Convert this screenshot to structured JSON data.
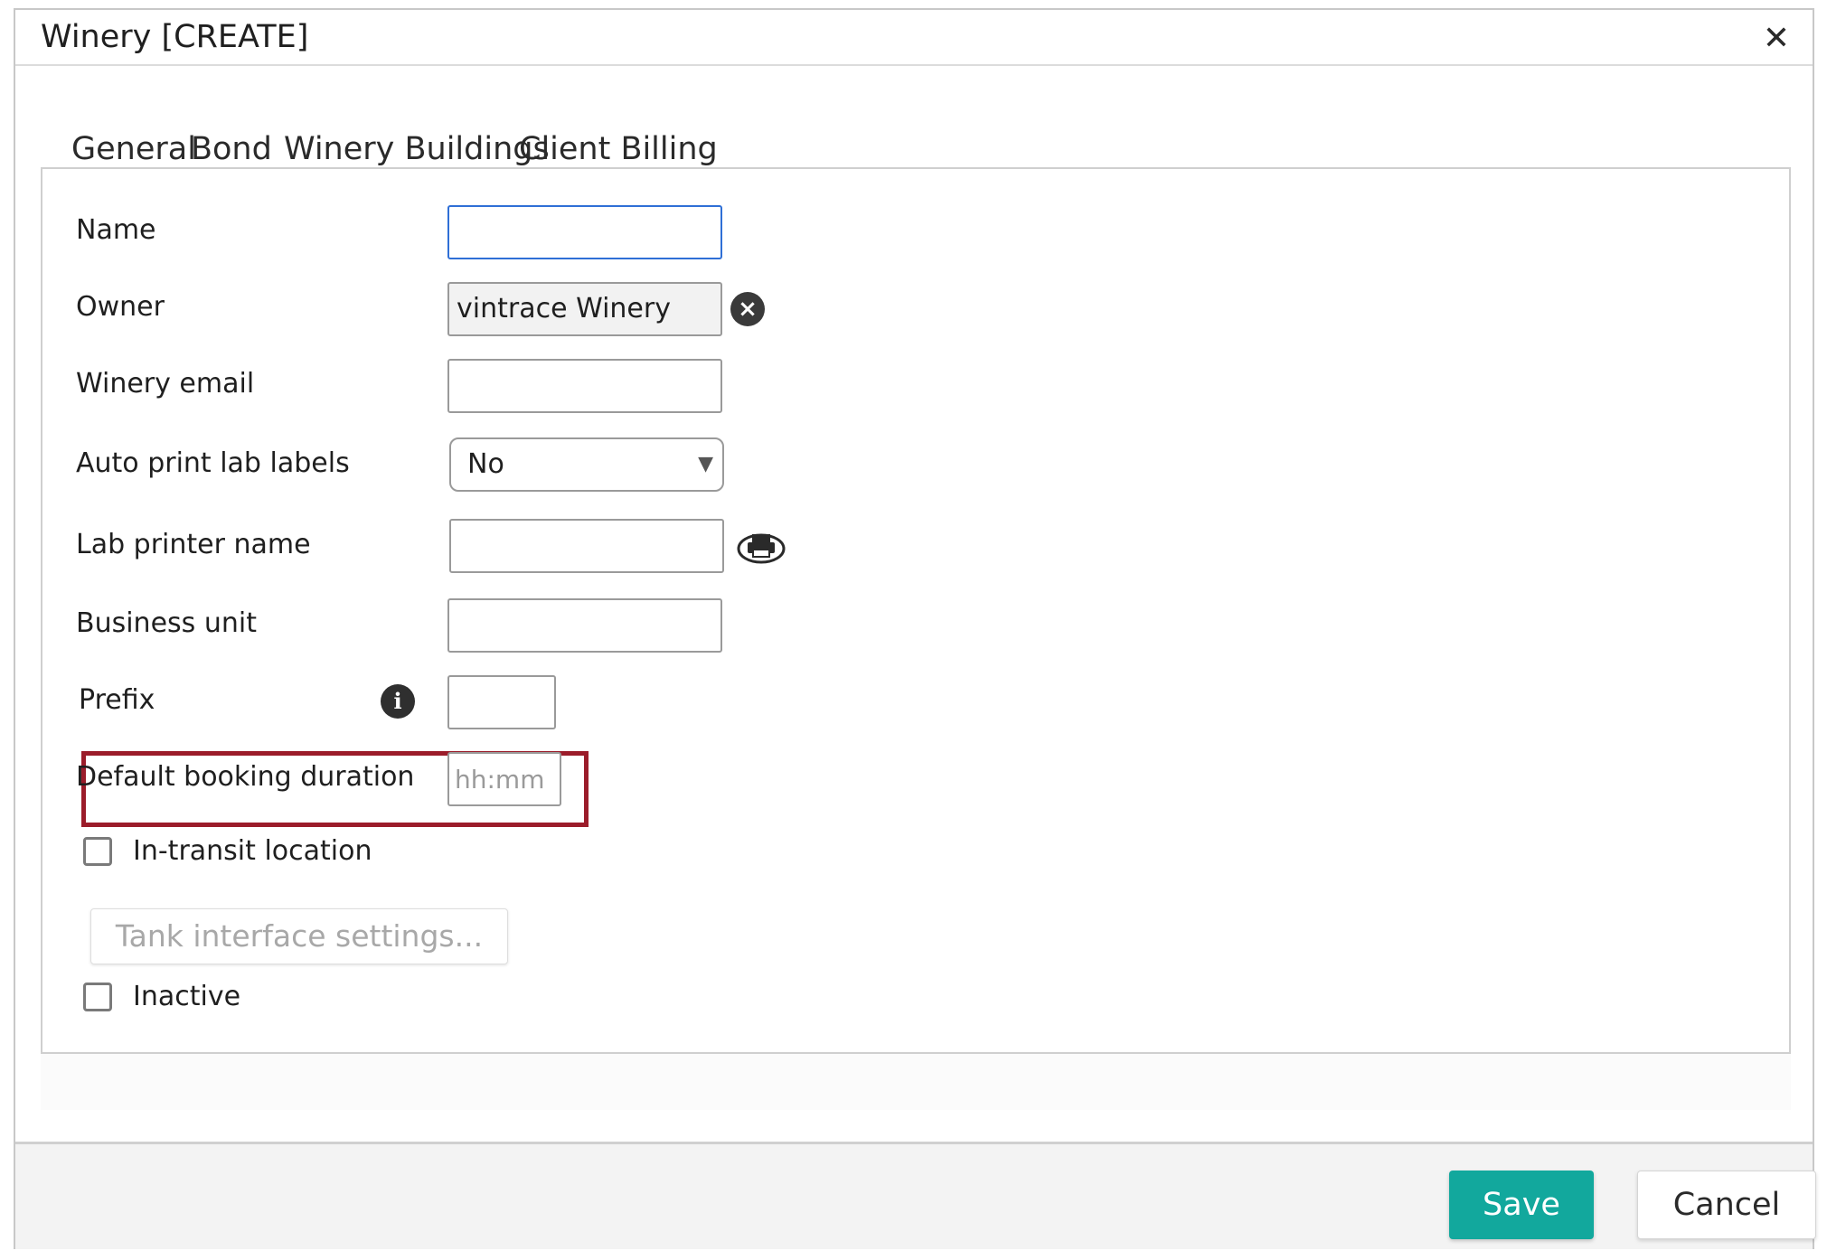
{
  "dialog": {
    "title": "Winery [CREATE]",
    "close_icon": "close-icon"
  },
  "tabs": [
    {
      "label": "General",
      "active": true
    },
    {
      "label": "Bond",
      "active": false
    },
    {
      "label": "Winery Buildings",
      "active": false
    },
    {
      "label": "Client Billing",
      "active": false
    }
  ],
  "form": {
    "name": {
      "label": "Name",
      "value": ""
    },
    "owner": {
      "label": "Owner",
      "value": "vintrace Winery",
      "clear_icon": "clear-icon"
    },
    "winery_email": {
      "label": "Winery email",
      "value": ""
    },
    "auto_print": {
      "label": "Auto print lab labels",
      "selected": "No"
    },
    "lab_printer": {
      "label": "Lab printer name",
      "value": "",
      "icon": "printer-icon"
    },
    "business_unit": {
      "label": "Business unit",
      "value": ""
    },
    "prefix": {
      "label": "Prefix",
      "value": "",
      "info_icon": "info-icon"
    },
    "default_booking_duration": {
      "label": "Default booking duration",
      "placeholder": "hh:mm",
      "value": ""
    },
    "in_transit": {
      "label": "In-transit location",
      "checked": false
    },
    "tank_interface": {
      "label": "Tank interface settings...",
      "enabled": false
    },
    "inactive": {
      "label": "Inactive",
      "checked": false
    }
  },
  "footer": {
    "save_label": "Save",
    "cancel_label": "Cancel"
  },
  "colors": {
    "accent": "#12a89d",
    "highlight": "#9b1c2a",
    "focus": "#2f6fd6"
  }
}
